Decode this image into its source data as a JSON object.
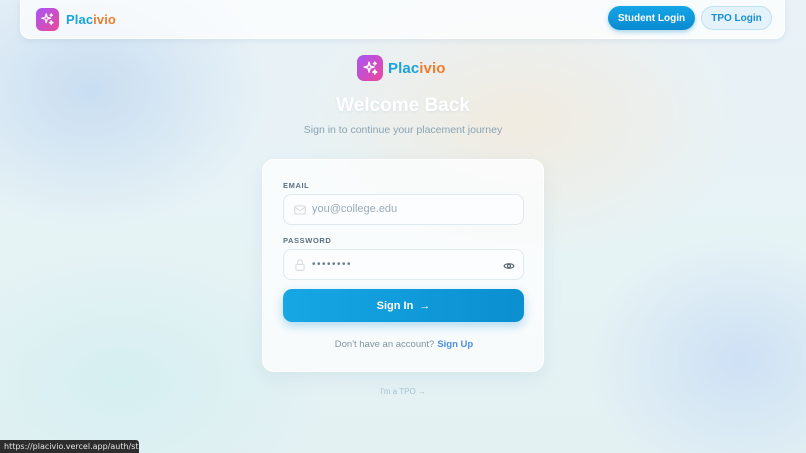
{
  "brand": {
    "part1": "Plac",
    "part2": "ivio",
    "accent_blue": "#1aa3dc",
    "accent_orange": "#f07d2e",
    "logo_gradient": [
      "#a855f7",
      "#ec4899"
    ],
    "logo_icon": "sparkles-icon"
  },
  "nav": {
    "student_login": "Student Login",
    "tpo_login": "TPO Login"
  },
  "header": {
    "title": "Welcome Back",
    "subtitle": "Sign in to continue your placement journey"
  },
  "form": {
    "email_label": "EMAIL",
    "email_placeholder": "you@college.edu",
    "email_icon": "mail-icon",
    "password_label": "PASSWORD",
    "password_value": "••••••••",
    "password_icon": "lock-icon",
    "eye_icon": "eye-icon",
    "submit_label": "Sign In",
    "submit_arrow": "→",
    "no_account_text": "Don't have an account?",
    "signup_link": "Sign Up"
  },
  "alt_link": "I'm a TPO →",
  "status_url": "https://placivio.vercel.app/auth/student"
}
